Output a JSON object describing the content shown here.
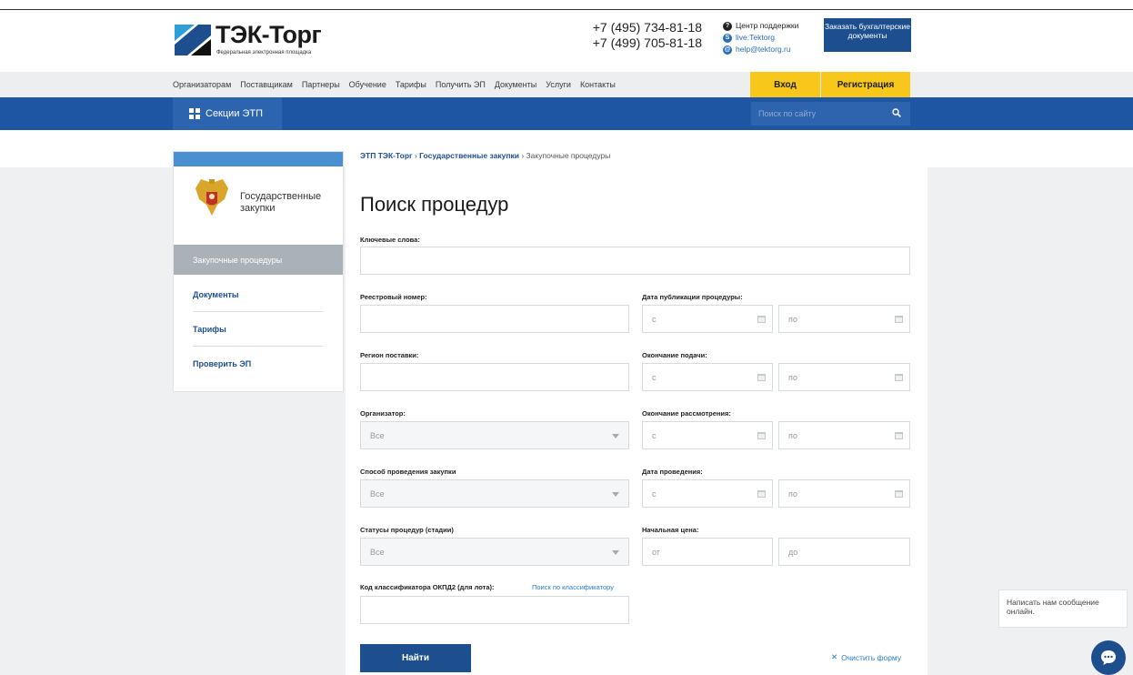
{
  "header": {
    "logo_title": "ТЭК-Торг",
    "logo_subtitle": "Федеральная электронная площадка",
    "phone1": "+7 (495) 734-81-18",
    "phone2": "+7 (499) 705-81-18",
    "support_label": "Центр поддержки",
    "skype": "live:Tektorg",
    "email": "help@tektorg.ru",
    "order_button": "Заказать бухгалтерские документы"
  },
  "nav": {
    "items": [
      "Организаторам",
      "Поставщикам",
      "Партнеры",
      "Обучение",
      "Тарифы",
      "Получить ЭП",
      "Документы",
      "Услуги",
      "Контакты"
    ],
    "login": "Вход",
    "register": "Регистрация"
  },
  "bluebar": {
    "sections_label": "Секции ЭТП",
    "search_placeholder": "Поиск по сайту"
  },
  "sidebar": {
    "title": "Государственные закупки",
    "active_item": "Закупочные процедуры",
    "items": [
      "Документы",
      "Тарифы",
      "Проверить ЭП"
    ]
  },
  "breadcrumb": {
    "item1": "ЭТП ТЭК-Торг",
    "item2": "Государственные закупки",
    "current": "Закупочные процедуры"
  },
  "form": {
    "title": "Поиск процедур",
    "keywords_label": "Ключевые слова:",
    "registry_label": "Реестровый номер:",
    "pubdate_label": "Дата публикации процедуры:",
    "region_label": "Регион поставки:",
    "submit_end_label": "Окончание подачи:",
    "organizer_label": "Организатор:",
    "review_end_label": "Окончание рассмотрения:",
    "method_label": "Способ проведения закупки",
    "holding_date_label": "Дата проведения:",
    "status_label": "Статусы процедур (стадии)",
    "start_price_label": "Начальная цена:",
    "okpd_label": "Код классификатора ОКПД2 (для лота):",
    "classifier_link": "Поиск по классификатору",
    "from_placeholder": "с",
    "to_placeholder": "по",
    "price_from": "от",
    "price_to": "до",
    "select_all": "Все",
    "find_button": "Найти",
    "clear_link": "Очистить форму"
  },
  "chat": {
    "message": "Написать нам сообщение онлайн."
  }
}
